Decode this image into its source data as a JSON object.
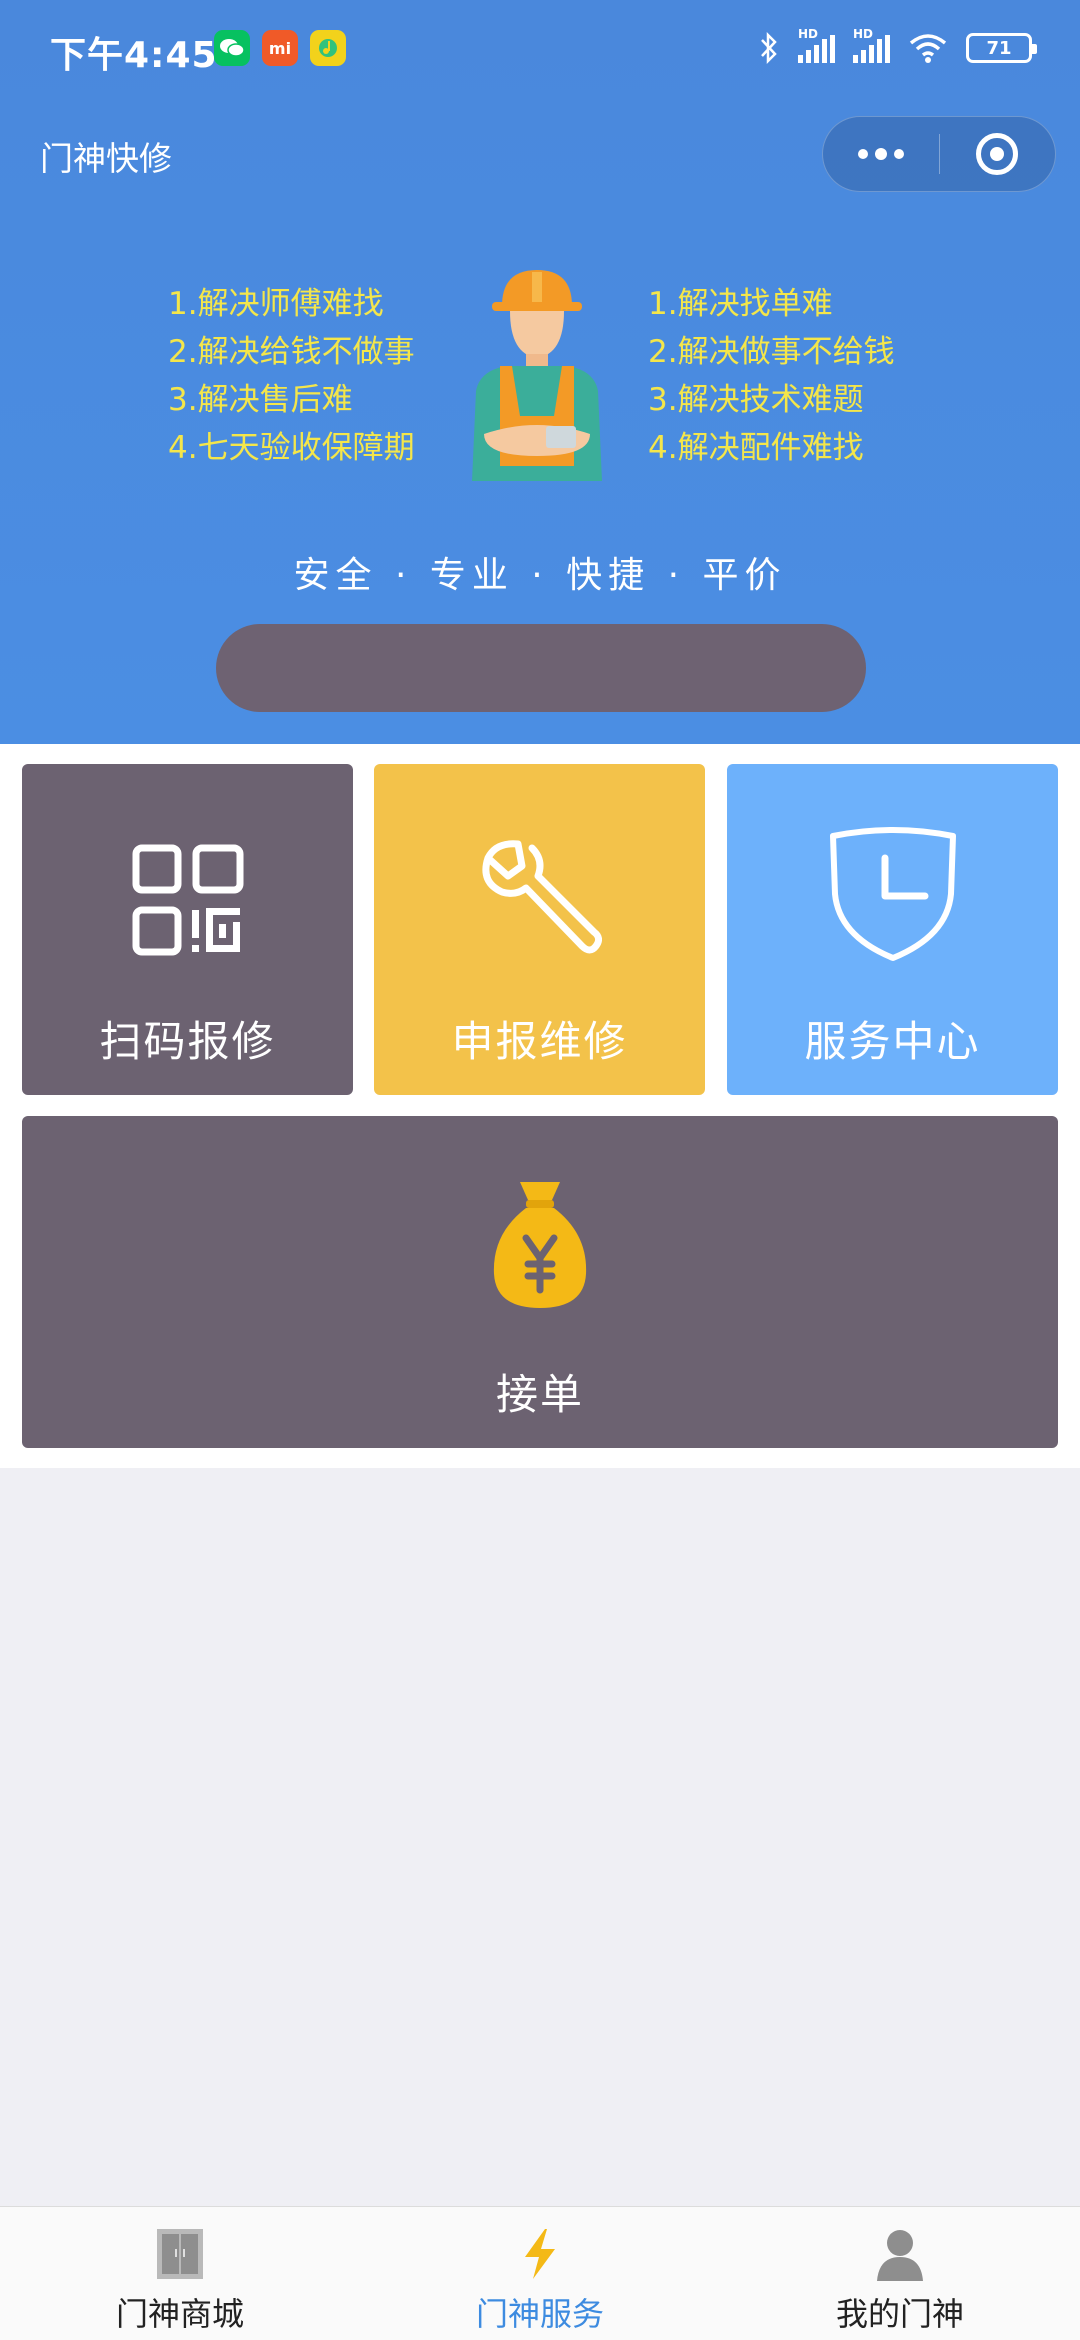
{
  "status_bar": {
    "time": "下午4:45",
    "apps": [
      {
        "icon": "wechat-icon",
        "color": "#07c160"
      },
      {
        "icon": "mi-icon",
        "label": "mi",
        "color": "#f05a28"
      },
      {
        "icon": "music-icon",
        "color": "#f2d21b"
      }
    ],
    "signal_label": "HD",
    "battery": "71"
  },
  "nav": {
    "title": "门神快修",
    "more_icon": "more-dots-icon",
    "close_icon": "target-close-icon"
  },
  "banner": {
    "left_features": [
      "1.解决师傅难找",
      "2.解决给钱不做事",
      "3.解决售后难",
      "4.七天验收保障期"
    ],
    "right_features": [
      "1.解决找单难",
      "2.解决做事不给钱",
      "3.解决技术难题",
      "4.解决配件难找"
    ],
    "slogan": "安全 · 专业 · 快捷 · 平价",
    "colors": {
      "background": "#4a88dc",
      "feature_text": "#f4e64a",
      "search_pill": "#6e6272"
    }
  },
  "tiles": [
    {
      "label": "扫码报修",
      "icon": "qr-code-icon",
      "color": "#6c6271"
    },
    {
      "label": "申报维修",
      "icon": "wrench-icon",
      "color": "#f3c24a"
    },
    {
      "label": "服务中心",
      "icon": "shield-clock-icon",
      "color": "#6db1fb"
    },
    {
      "label": "接单",
      "icon": "money-bag-icon",
      "color": "#6c6271"
    }
  ],
  "tabbar": {
    "items": [
      {
        "label": "门神商城",
        "icon": "door-icon",
        "active": false
      },
      {
        "label": "门神服务",
        "icon": "lightning-icon",
        "active": true
      },
      {
        "label": "我的门神",
        "icon": "user-icon",
        "active": false
      }
    ],
    "active_color": "#3d8be0"
  }
}
